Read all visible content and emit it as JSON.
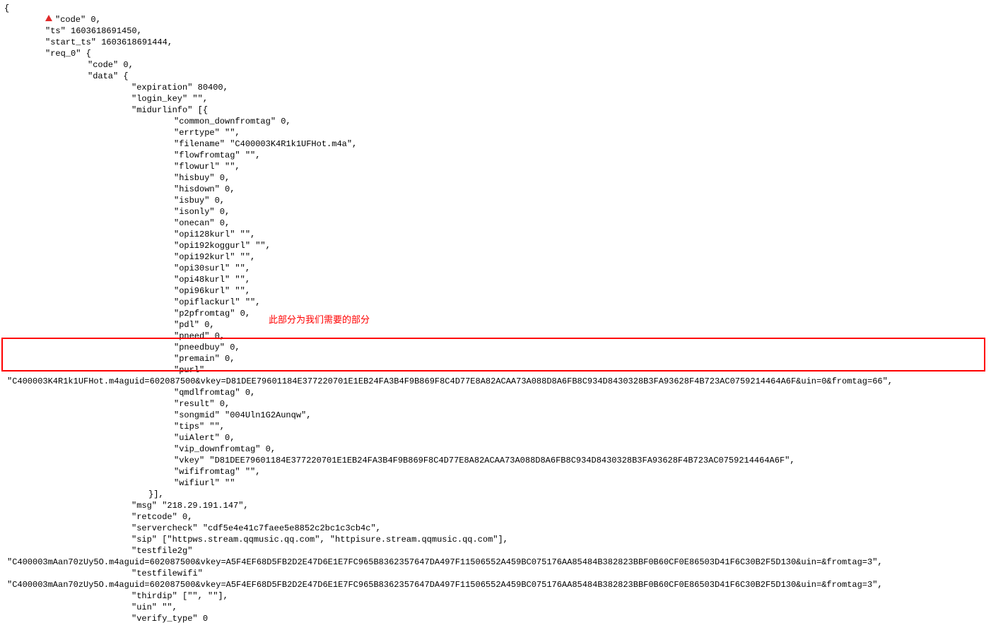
{
  "annotation": "此部分为我们需要的部分",
  "open_brace": "{",
  "l_code": "\"code\" 0,",
  "l_ts": "\"ts\" 1603618691450,",
  "l_start_ts": "\"start_ts\" 1603618691444,",
  "l_req0": "\"req_0\" {",
  "l_req0_code": "\"code\" 0,",
  "l_req0_data": "\"data\" {",
  "d_expiration": "\"expiration\" 80400,",
  "d_login_key": "\"login_key\" \"\",",
  "d_midurlinfo": "\"midurlinfo\" [{",
  "m_common_downfromtag": "\"common_downfromtag\" 0,",
  "m_errtype": "\"errtype\" \"\",",
  "m_filename": "\"filename\" \"C400003K4R1k1UFHot.m4a\",",
  "m_flowfromtag": "\"flowfromtag\" \"\",",
  "m_flowurl": "\"flowurl\" \"\",",
  "m_hisbuy": "\"hisbuy\" 0,",
  "m_hisdown": "\"hisdown\" 0,",
  "m_isbuy": "\"isbuy\" 0,",
  "m_isonly": "\"isonly\" 0,",
  "m_onecan": "\"onecan\" 0,",
  "m_opi128kurl": "\"opi128kurl\" \"\",",
  "m_opi192koggurl": "\"opi192koggurl\" \"\",",
  "m_opi192kurl": "\"opi192kurl\" \"\",",
  "m_opi30surl": "\"opi30surl\" \"\",",
  "m_opi48kurl": "\"opi48kurl\" \"\",",
  "m_opi96kurl": "\"opi96kurl\" \"\",",
  "m_opiflackurl": "\"opiflackurl\" \"\",",
  "m_p2pfromtag": "\"p2pfromtag\" 0,",
  "m_pdl": "\"pdl\" 0,",
  "m_pneed": "\"pneed\" 0,",
  "m_pneedbuy": "\"pneedbuy\" 0,",
  "m_premain": "\"premain\" 0,",
  "m_purl_key": "\"purl\"",
  "m_purl_val": "\"C400003K4R1k1UFHot.m4aguid=602087500&vkey=D81DEE79601184E377220701E1EB24FA3B4F9B869F8C4D77E8A82ACAA73A088D8A6FB8C934D8430328B3FA93628F4B723AC0759214464A6F&uin=0&fromtag=66\",",
  "m_qmdlfromtag": "\"qmdlfromtag\" 0,",
  "m_result": "\"result\" 0,",
  "m_songmid": "\"songmid\" \"004Uln1G2Aunqw\",",
  "m_tips": "\"tips\" \"\",",
  "m_uiAlert": "\"uiAlert\" 0,",
  "m_vip_downfromtag": "\"vip_downfromtag\" 0,",
  "m_vkey": "\"vkey\" \"D81DEE79601184E377220701E1EB24FA3B4F9B869F8C4D77E8A82ACAA73A088D8A6FB8C934D8430328B3FA93628F4B723AC0759214464A6F\",",
  "m_wififromtag": "\"wififromtag\" \"\",",
  "m_wifiurl": "\"wifiurl\" \"\"",
  "m_close": "}],",
  "d_msg": "\"msg\" \"218.29.191.147\",",
  "d_retcode": "\"retcode\" 0,",
  "d_servercheck": "\"servercheck\" \"cdf5e4e41c7faee5e8852c2bc1c3cb4c\",",
  "d_sip": "\"sip\" [\"httpws.stream.qqmusic.qq.com\", \"httpisure.stream.qqmusic.qq.com\"],",
  "d_testfile2g_key": "\"testfile2g\"",
  "d_testfile2g_val": "\"C400003mAan70zUy5O.m4aguid=602087500&vkey=A5F4EF68D5FB2D2E47D6E1E7FC965B8362357647DA497F11506552A459BC075176AA85484B382823BBF0B60CF0E86503D41F6C30B2F5D130&uin=&fromtag=3\",",
  "d_testfilewifi_key": "\"testfilewifi\"",
  "d_testfilewifi_val": "\"C400003mAan70zUy5O.m4aguid=602087500&vkey=A5F4EF68D5FB2D2E47D6E1E7FC965B8362357647DA497F11506552A459BC075176AA85484B382823BBF0B60CF0E86503D41F6C30B2F5D130&uin=&fromtag=3\",",
  "d_thirdip": "\"thirdip\" [\"\", \"\"],",
  "d_uin": "\"uin\" \"\",",
  "d_verify_type": "\"verify_type\" 0"
}
